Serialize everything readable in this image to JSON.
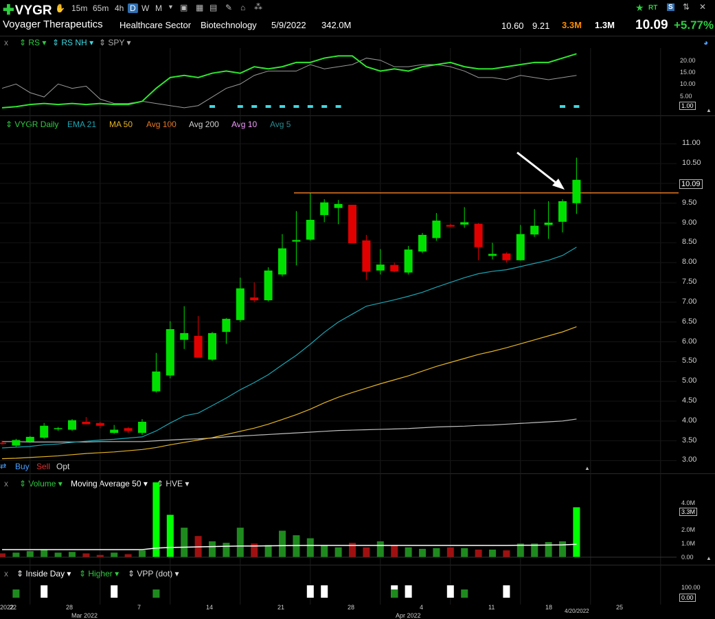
{
  "header": {
    "symbol": "VYGR",
    "timeframes": [
      "15m",
      "65m",
      "4h",
      "D",
      "W",
      "M"
    ],
    "selected_timeframe": "D",
    "company": "Voyager Therapeutics",
    "sector": "Healthcare Sector",
    "industry": "Biotechnology",
    "date": "5/9/2022",
    "market_cap": "342.0M",
    "high": "10.60",
    "low": "9.21",
    "volume": "3.3M",
    "avg_volume": "1.3M",
    "last": "10.09",
    "change": "+5.77%",
    "rt_label": "RT"
  },
  "colors": {
    "up": "#00e000",
    "down": "#e00000",
    "ema21": "#19a7b5",
    "ma50": "#e6b422",
    "avg200": "#bfbfbf",
    "resistance": "#e87722",
    "rs": "#2ee82e",
    "orange_vol": "#ff8c00"
  },
  "rs_panel": {
    "legend": [
      "RS",
      "RS NH",
      "SPY"
    ],
    "ticks": [
      "20.00",
      "15.00",
      "10.00",
      "5.00",
      "0.00"
    ],
    "box": "1.00"
  },
  "price_panel": {
    "legend": [
      "VYGR Daily",
      "EMA 21",
      "MA 50",
      "Avg 100",
      "Avg 200",
      "Avg 10",
      "Avg 5"
    ],
    "ticks": [
      "11.00",
      "10.50",
      "10.00",
      "9.50",
      "9.00",
      "8.50",
      "8.00",
      "7.50",
      "7.00",
      "6.50",
      "6.00",
      "5.50",
      "5.00",
      "4.50",
      "4.00",
      "3.50",
      "3.00"
    ],
    "price_box": "10.09",
    "trade_buttons": [
      "Buy",
      "Sell",
      "Opt"
    ]
  },
  "volume_panel": {
    "legend": [
      "Volume",
      "Moving Average 50",
      "HVE"
    ],
    "ticks": [
      "4.0M",
      "3.0M",
      "2.0M",
      "1.0M",
      "0.00"
    ],
    "box": "3.3M"
  },
  "indicator_panel": {
    "legend": [
      "Inside Day",
      "Higher",
      "VPP (dot)"
    ],
    "ticks": [
      "100.00",
      "0.00"
    ],
    "box": "0.00"
  },
  "x_axis": {
    "labels": [
      "2022",
      "22",
      "28",
      "Mar 2022",
      "7",
      "14",
      "21",
      "28",
      "Apr 2022",
      "4",
      "11",
      "18",
      "4/20/2022",
      "25"
    ]
  },
  "chart_data": {
    "type": "candlestick",
    "ylim": [
      2.8,
      11.3
    ],
    "resistance": 9.76,
    "candles": [
      {
        "o": 3.45,
        "h": 3.5,
        "l": 3.4,
        "c": 3.42
      },
      {
        "o": 3.38,
        "h": 3.55,
        "l": 3.35,
        "c": 3.52
      },
      {
        "o": 3.48,
        "h": 3.62,
        "l": 3.45,
        "c": 3.6
      },
      {
        "o": 3.58,
        "h": 3.95,
        "l": 3.55,
        "c": 3.88
      },
      {
        "o": 3.8,
        "h": 3.85,
        "l": 3.75,
        "c": 3.82
      },
      {
        "o": 3.78,
        "h": 4.05,
        "l": 3.75,
        "c": 4.02
      },
      {
        "o": 3.98,
        "h": 4.1,
        "l": 3.92,
        "c": 3.92
      },
      {
        "o": 3.95,
        "h": 3.98,
        "l": 3.82,
        "c": 3.88
      },
      {
        "o": 3.7,
        "h": 3.9,
        "l": 3.68,
        "c": 3.78
      },
      {
        "o": 3.82,
        "h": 3.85,
        "l": 3.7,
        "c": 3.75
      },
      {
        "o": 3.7,
        "h": 4.05,
        "l": 3.65,
        "c": 3.98
      },
      {
        "o": 4.75,
        "h": 5.72,
        "l": 4.72,
        "c": 5.25
      },
      {
        "o": 5.15,
        "h": 6.52,
        "l": 5.08,
        "c": 6.32
      },
      {
        "o": 6.05,
        "h": 6.9,
        "l": 5.82,
        "c": 6.22
      },
      {
        "o": 6.15,
        "h": 6.65,
        "l": 5.6,
        "c": 5.6
      },
      {
        "o": 5.55,
        "h": 6.25,
        "l": 5.52,
        "c": 6.22
      },
      {
        "o": 6.25,
        "h": 6.6,
        "l": 5.95,
        "c": 6.58
      },
      {
        "o": 6.55,
        "h": 7.62,
        "l": 6.5,
        "c": 7.35
      },
      {
        "o": 7.12,
        "h": 7.5,
        "l": 7.0,
        "c": 7.05
      },
      {
        "o": 7.05,
        "h": 7.88,
        "l": 7.02,
        "c": 7.8
      },
      {
        "o": 7.7,
        "h": 8.72,
        "l": 7.65,
        "c": 8.36
      },
      {
        "o": 8.53,
        "h": 9.3,
        "l": 7.93,
        "c": 8.57
      },
      {
        "o": 8.58,
        "h": 9.76,
        "l": 8.55,
        "c": 9.08
      },
      {
        "o": 9.2,
        "h": 9.6,
        "l": 9.02,
        "c": 9.52
      },
      {
        "o": 9.38,
        "h": 9.58,
        "l": 8.97,
        "c": 9.48
      },
      {
        "o": 9.46,
        "h": 9.46,
        "l": 8.49,
        "c": 8.49
      },
      {
        "o": 8.56,
        "h": 8.7,
        "l": 7.56,
        "c": 7.77
      },
      {
        "o": 7.8,
        "h": 8.34,
        "l": 7.7,
        "c": 7.95
      },
      {
        "o": 7.94,
        "h": 8.0,
        "l": 7.76,
        "c": 7.78
      },
      {
        "o": 7.75,
        "h": 8.42,
        "l": 7.7,
        "c": 8.33
      },
      {
        "o": 8.28,
        "h": 8.75,
        "l": 8.24,
        "c": 8.7
      },
      {
        "o": 8.62,
        "h": 9.25,
        "l": 8.55,
        "c": 9.06
      },
      {
        "o": 8.95,
        "h": 8.98,
        "l": 8.9,
        "c": 8.91
      },
      {
        "o": 8.96,
        "h": 9.4,
        "l": 8.88,
        "c": 9.02
      },
      {
        "o": 8.98,
        "h": 9.0,
        "l": 8.06,
        "c": 8.39
      },
      {
        "o": 8.17,
        "h": 8.5,
        "l": 8.08,
        "c": 8.22
      },
      {
        "o": 8.23,
        "h": 8.26,
        "l": 8.0,
        "c": 8.06
      },
      {
        "o": 8.06,
        "h": 8.95,
        "l": 8.05,
        "c": 8.72
      },
      {
        "o": 8.71,
        "h": 9.35,
        "l": 8.65,
        "c": 8.93
      },
      {
        "o": 8.95,
        "h": 9.55,
        "l": 8.6,
        "c": 9.01
      },
      {
        "o": 9.03,
        "h": 9.6,
        "l": 8.76,
        "c": 9.55
      },
      {
        "o": 9.5,
        "h": 10.65,
        "l": 9.23,
        "c": 10.09
      }
    ],
    "ema21": [
      3.32,
      3.34,
      3.36,
      3.4,
      3.42,
      3.46,
      3.49,
      3.52,
      3.54,
      3.57,
      3.6,
      3.75,
      3.95,
      4.13,
      4.2,
      4.39,
      4.58,
      4.79,
      4.97,
      5.17,
      5.42,
      5.66,
      5.94,
      6.24,
      6.5,
      6.7,
      6.9,
      6.98,
      7.06,
      7.15,
      7.25,
      7.38,
      7.5,
      7.62,
      7.72,
      7.78,
      7.82,
      7.9,
      7.98,
      8.06,
      8.18,
      8.39
    ],
    "ma50": [
      3.05,
      3.06,
      3.08,
      3.1,
      3.12,
      3.15,
      3.18,
      3.2,
      3.22,
      3.25,
      3.28,
      3.33,
      3.4,
      3.46,
      3.52,
      3.58,
      3.66,
      3.74,
      3.82,
      3.92,
      4.04,
      4.16,
      4.3,
      4.46,
      4.6,
      4.72,
      4.83,
      4.94,
      5.04,
      5.14,
      5.26,
      5.38,
      5.48,
      5.58,
      5.68,
      5.76,
      5.85,
      5.95,
      6.05,
      6.15,
      6.25,
      6.38
    ],
    "avg200": [
      3.48,
      3.48,
      3.47,
      3.47,
      3.47,
      3.47,
      3.47,
      3.48,
      3.48,
      3.48,
      3.48,
      3.5,
      3.52,
      3.54,
      3.55,
      3.57,
      3.6,
      3.62,
      3.64,
      3.66,
      3.68,
      3.7,
      3.72,
      3.74,
      3.76,
      3.77,
      3.78,
      3.79,
      3.8,
      3.81,
      3.83,
      3.85,
      3.86,
      3.87,
      3.89,
      3.9,
      3.92,
      3.94,
      3.96,
      3.98,
      4.0,
      4.05
    ],
    "volume": {
      "ylim": [
        0,
        4.5
      ],
      "values": [
        0.25,
        0.3,
        0.4,
        0.5,
        0.3,
        0.35,
        0.25,
        0.15,
        0.3,
        0.2,
        0.45,
        5.0,
        2.8,
        1.95,
        1.4,
        1.05,
        0.95,
        1.95,
        0.9,
        0.8,
        1.75,
        1.45,
        1.25,
        0.75,
        0.65,
        0.95,
        0.65,
        1.05,
        0.75,
        0.65,
        0.55,
        0.6,
        0.65,
        0.6,
        0.5,
        0.5,
        0.45,
        0.9,
        0.9,
        1.0,
        1.05,
        3.3
      ],
      "ma50": [
        0.5,
        0.5,
        0.5,
        0.5,
        0.5,
        0.5,
        0.5,
        0.5,
        0.5,
        0.5,
        0.5,
        0.6,
        0.64,
        0.66,
        0.68,
        0.7,
        0.72,
        0.74,
        0.74,
        0.75,
        0.76,
        0.77,
        0.78,
        0.78,
        0.78,
        0.78,
        0.78,
        0.78,
        0.78,
        0.78,
        0.78,
        0.78,
        0.78,
        0.78,
        0.78,
        0.78,
        0.78,
        0.79,
        0.79,
        0.8,
        0.81,
        0.85
      ]
    },
    "rs_line": [
      1,
      1.5,
      2.5,
      3,
      2.5,
      3,
      2.5,
      3,
      2.5,
      2.5,
      4,
      10,
      15,
      16,
      15,
      17,
      18,
      17,
      20,
      19,
      20,
      22,
      22,
      24,
      25,
      25,
      20,
      18,
      19,
      18,
      20,
      21,
      22,
      20,
      19,
      19,
      20,
      21,
      22,
      22,
      24,
      26
    ],
    "spy_line": [
      10,
      12,
      8,
      6,
      12,
      10,
      11,
      5,
      3,
      3,
      4,
      3,
      2,
      1,
      2,
      6,
      10,
      12,
      16,
      18,
      18,
      18,
      21,
      19,
      20,
      21,
      24,
      23,
      20,
      20,
      21,
      21,
      20,
      18,
      15,
      15,
      14,
      16,
      15,
      14,
      15,
      16
    ],
    "higher_days": [
      0,
      1,
      0,
      0,
      0,
      0,
      0,
      0,
      0,
      0,
      0,
      1,
      0,
      0,
      0,
      0,
      0,
      0,
      0,
      0,
      0,
      0,
      0,
      0,
      0,
      0,
      0,
      0,
      1,
      0,
      0,
      0,
      0,
      1,
      0,
      0,
      0,
      0,
      0,
      0,
      0,
      0
    ],
    "inside_days": [
      0,
      0,
      0,
      1,
      0,
      0,
      0,
      0,
      1,
      0,
      0,
      0,
      0,
      0,
      0,
      0,
      0,
      0,
      0,
      0,
      0,
      0,
      1,
      1,
      0,
      0,
      0,
      0,
      1,
      1,
      0,
      0,
      1,
      0,
      0,
      0,
      1,
      0,
      0,
      0,
      0,
      0
    ]
  }
}
